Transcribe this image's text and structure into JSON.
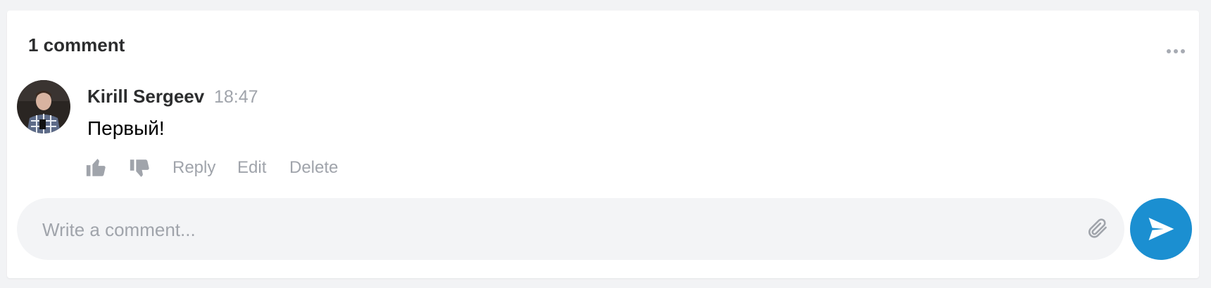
{
  "comments_section": {
    "title": "1 comment",
    "more_icon": "more-dots-icon"
  },
  "comment": {
    "author": "Kirill Sergeev",
    "time": "18:47",
    "text": "Первый!",
    "like_icon": "thumbs-up-icon",
    "dislike_icon": "thumbs-down-icon",
    "reply_label": "Reply",
    "edit_label": "Edit",
    "delete_label": "Delete"
  },
  "composer": {
    "placeholder": "Write a comment...",
    "value": "",
    "attach_icon": "paperclip-icon",
    "send_icon": "send-icon"
  },
  "colors": {
    "accent": "#1b8fd1",
    "muted": "#a0a4ab",
    "text": "#2c2d2e",
    "input_bg": "#f3f4f6"
  }
}
